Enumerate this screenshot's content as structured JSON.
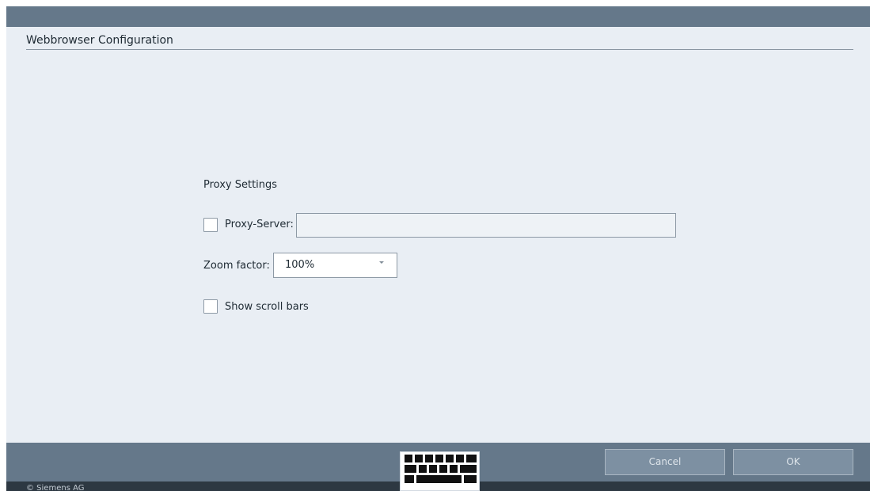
{
  "dialog": {
    "title": "Webbrowser Configuration"
  },
  "proxy": {
    "section_title": "Proxy Settings",
    "checkbox_checked": false,
    "label": "Proxy-Server:",
    "value": ""
  },
  "zoom": {
    "label": "Zoom factor:",
    "value": "100%"
  },
  "scrollbars": {
    "checkbox_checked": false,
    "label": "Show scroll bars"
  },
  "footer": {
    "cancel_label": "Cancel",
    "ok_label": "OK",
    "copyright": "© Siemens AG",
    "keyboard_icon": "keyboard-icon"
  },
  "colors": {
    "bar": "#65788a",
    "background": "#e9eef4",
    "status_bar": "#2d3842",
    "button": "#7d90a2"
  }
}
